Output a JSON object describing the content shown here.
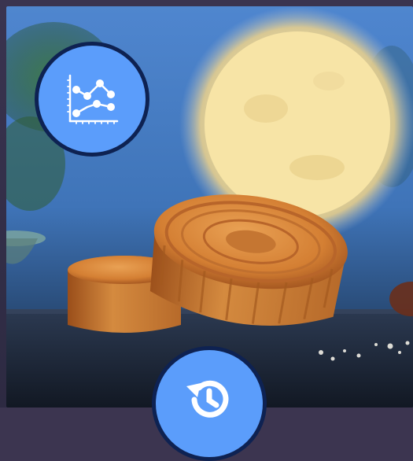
{
  "scene": {
    "description_alt": "",
    "sky_color": "#5b8bc9",
    "moon_color": "#f6e3a3",
    "mooncake_color": "#d8893b",
    "table_color": "#1e2532"
  },
  "buttons": {
    "chart_icon": "line-chart-icon",
    "history_icon": "history-icon"
  },
  "colors": {
    "fab_fill": "#5b9dfb",
    "fab_border": "#0e2252",
    "icon": "#ffffff"
  }
}
